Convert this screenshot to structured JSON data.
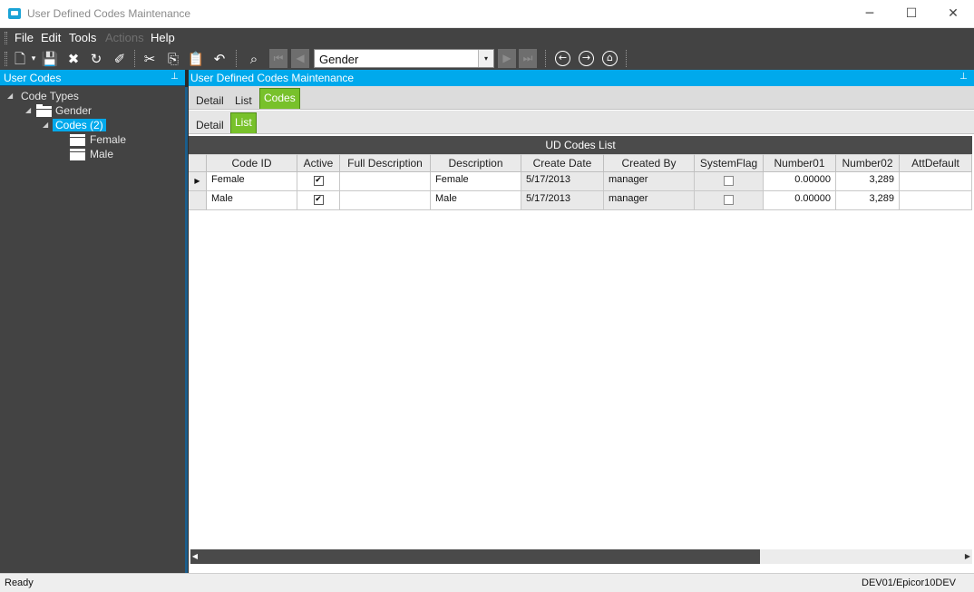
{
  "window": {
    "title": "User Defined Codes Maintenance",
    "min": "─",
    "max": "☐",
    "close": "✕"
  },
  "menu": [
    "File",
    "Edit",
    "Tools",
    "Actions",
    "Help"
  ],
  "toolbar": {
    "new": "🗋",
    "dropdown": "▾",
    "save": "💾",
    "delete": "✖",
    "refresh": "↻",
    "clear": "✐",
    "cut": "✂",
    "copy": "⎘",
    "paste": "📋",
    "undo": "↶",
    "search": "⌕",
    "first": "⏮",
    "prev": "◀",
    "next": "▶",
    "last": "⏭",
    "back": "←",
    "forward": "→",
    "home": "⌂"
  },
  "nav": {
    "value": "Gender",
    "arrow": "▾"
  },
  "left_panel": {
    "title": "User Codes",
    "pin": "⊥",
    "tree": {
      "root": "Code Types",
      "type": "Gender",
      "codes": "Codes (2)",
      "items": [
        "Female",
        "Male"
      ],
      "arrow": "◢"
    }
  },
  "right_panel": {
    "title": "User Defined Codes Maintenance",
    "pin": "⊥",
    "tabs": [
      "Detail",
      "List",
      "Codes"
    ],
    "subtabs": [
      "Detail",
      "List"
    ],
    "grid": {
      "caption": "UD Codes List",
      "columns": [
        "Code ID",
        "Active",
        "Full Description",
        "Description",
        "Create Date",
        "Created By",
        "SystemFlag",
        "Number01",
        "Number02",
        "AttDefault"
      ],
      "rows": [
        {
          "code_id": "Female",
          "active": true,
          "full_description": "",
          "description": "Female",
          "create_date": "5/17/2013",
          "created_by": "manager",
          "system_flag": false,
          "number01": "0.00000",
          "number02": "3,289",
          "att_default": ""
        },
        {
          "code_id": "Male",
          "active": true,
          "full_description": "",
          "description": "Male",
          "create_date": "5/17/2013",
          "created_by": "manager",
          "system_flag": false,
          "number01": "0.00000",
          "number02": "3,289",
          "att_default": ""
        }
      ],
      "selector": "▶",
      "check": "✔"
    },
    "scroll_left": "◀",
    "scroll_right": "▶"
  },
  "status": {
    "left": "Ready",
    "right": "DEV01/Epicor10DEV"
  },
  "colors": {
    "accent": "#00a9ec",
    "tab_active": "#78c12b",
    "chrome": "#434343"
  }
}
